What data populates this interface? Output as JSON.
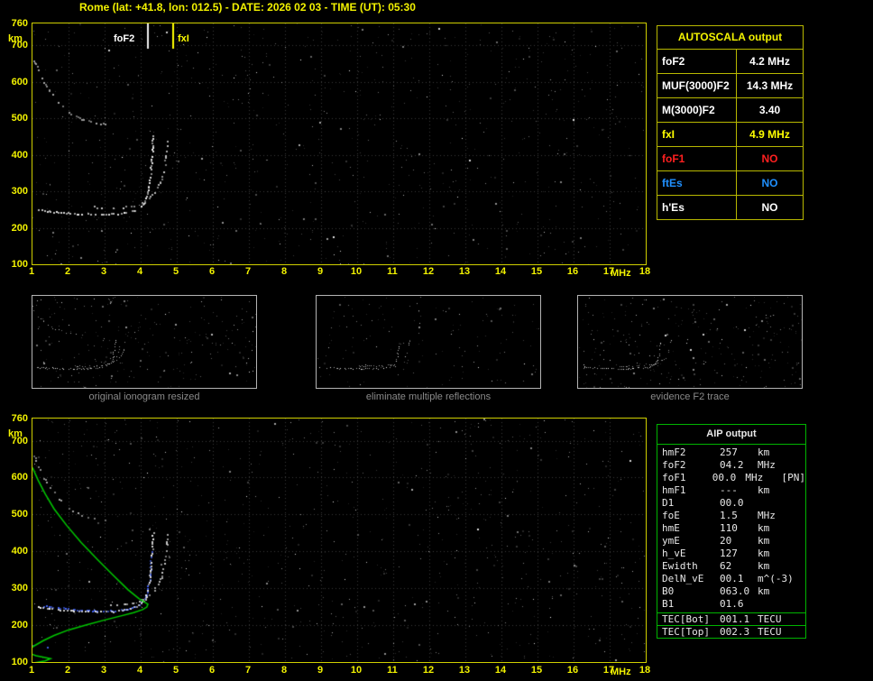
{
  "header": {
    "title": "Rome (lat: +41.8, lon: 012.5) - DATE: 2026 02 03 - TIME (UT): 05:30"
  },
  "colors": {
    "background": "#000000",
    "axis_yellow": "#f2f200",
    "plot_border": "#cfcf00",
    "caption_gray": "#8a8a8a",
    "autoscala_border": "#b8b800",
    "aip_border": "#00b400",
    "profile_green": "#00c800",
    "restored_blue": "#4868ff"
  },
  "autoscala_table": {
    "title": "AUTOSCALA output",
    "rows": [
      {
        "label": "foF2",
        "value": "4.2 MHz",
        "color": "#ffffff"
      },
      {
        "label": "MUF(3000)F2",
        "value": "14.3 MHz",
        "color": "#ffffff"
      },
      {
        "label": "M(3000)F2",
        "value": "3.40",
        "color": "#ffffff"
      },
      {
        "label": "fxI",
        "value": "4.9 MHz",
        "color": "#ffff00"
      },
      {
        "label": "foF1",
        "value": "NO",
        "color": "#ff2020"
      },
      {
        "label": "ftEs",
        "value": "NO",
        "color": "#2090ff"
      },
      {
        "label": "h'Es",
        "value": "NO",
        "color": "#ffffff"
      }
    ]
  },
  "thumbnails": [
    {
      "caption": "original ionogram resized",
      "trace_indices": [
        0,
        1,
        2
      ],
      "noise": 260,
      "seed": 31,
      "xlim": [
        1,
        10
      ],
      "ylim": [
        100,
        760
      ]
    },
    {
      "caption": "eliminate multiple reflections",
      "trace_indices": [
        1,
        2
      ],
      "noise": 150,
      "seed": 32,
      "xlim": [
        1,
        10
      ],
      "ylim": [
        100,
        760
      ]
    },
    {
      "caption": "evidence F2 trace",
      "trace_indices": [
        1,
        2
      ],
      "noise": 300,
      "seed": 33,
      "xlim": [
        1,
        10
      ],
      "ylim": [
        100,
        760
      ]
    }
  ],
  "aip_table": {
    "title": "AIP output",
    "rows": [
      {
        "label": "hmF2",
        "value": "257",
        "unit": "km",
        "note": ""
      },
      {
        "label": "foF2",
        "value": "04.2",
        "unit": "MHz",
        "note": ""
      },
      {
        "label": "foF1",
        "value": "00.0",
        "unit": "MHz",
        "note": "[PN]"
      },
      {
        "label": "hmF1",
        "value": "---",
        "unit": "km",
        "note": ""
      },
      {
        "label": "D1",
        "value": "00.0",
        "unit": "",
        "note": ""
      },
      {
        "label": "foE",
        "value": "1.5",
        "unit": "MHz",
        "note": ""
      },
      {
        "label": "hmE",
        "value": "110",
        "unit": "km",
        "note": ""
      },
      {
        "label": "ymE",
        "value": "20",
        "unit": "km",
        "note": ""
      },
      {
        "label": "h_vE",
        "value": "127",
        "unit": "km",
        "note": ""
      },
      {
        "label": "Ewidth",
        "value": "62",
        "unit": "km",
        "note": ""
      },
      {
        "label": "DelN_vE",
        "value": "00.1",
        "unit": "m^(-3)",
        "note": ""
      },
      {
        "label": "B0",
        "value": "063.0",
        "unit": "km",
        "note": ""
      },
      {
        "label": "B1",
        "value": "01.6",
        "unit": "",
        "note": ""
      }
    ],
    "tec_rows": [
      {
        "label": "TEC[Bot]",
        "value": "001.1",
        "unit": "TECU",
        "note": ""
      },
      {
        "label": "TEC[Top]",
        "value": "002.3",
        "unit": "TECU",
        "note": ""
      }
    ]
  },
  "chart_data": [
    {
      "type": "scatter",
      "name": "scaled ionogram",
      "xlabel": "MHz",
      "ylabel": "km",
      "xlim": [
        1,
        18
      ],
      "ylim": [
        100,
        760
      ],
      "x_ticks": [
        1,
        2,
        3,
        4,
        5,
        6,
        7,
        8,
        9,
        10,
        11,
        12,
        13,
        14,
        15,
        16,
        17,
        18
      ],
      "y_ticks": [
        760,
        700,
        600,
        500,
        400,
        300,
        200,
        100
      ],
      "grid": true,
      "noise": {
        "count": 750,
        "seed": 123
      },
      "annotations": [
        {
          "label": "foF2",
          "freq": 4.2,
          "label_color": "#ffffff",
          "line_color": "#f0f0f0",
          "side": "left"
        },
        {
          "label": "fxI",
          "freq": 4.9,
          "label_color": "#ffff00",
          "line_color": "#ffff00",
          "side": "right"
        }
      ],
      "traces": [
        {
          "name": "multiple-reflection-trace",
          "color": "#b0b0b0",
          "size": 2,
          "drop": 0.5,
          "points": [
            [
              1.05,
              660
            ],
            [
              1.2,
              622
            ],
            [
              1.4,
              585
            ],
            [
              1.65,
              550
            ],
            [
              1.95,
              522
            ],
            [
              2.3,
              502
            ],
            [
              2.7,
              490
            ],
            [
              3.05,
              484
            ]
          ]
        },
        {
          "name": "F2-extraordinary",
          "color": "#c8c8c8",
          "size": 2,
          "drop": 0.45,
          "points": [
            [
              2.7,
              258
            ],
            [
              3.1,
              255
            ],
            [
              3.5,
              257
            ],
            [
              3.8,
              262
            ],
            [
              4.0,
              270
            ],
            [
              4.2,
              283
            ],
            [
              4.4,
              302
            ],
            [
              4.55,
              330
            ],
            [
              4.65,
              368
            ],
            [
              4.7,
              412
            ],
            [
              4.73,
              452
            ]
          ]
        },
        {
          "name": "F2-ordinary",
          "color": "#f0f0f0",
          "size": 2,
          "drop": 0.2,
          "points": [
            [
              1.15,
              252
            ],
            [
              1.5,
              246
            ],
            [
              1.9,
              242
            ],
            [
              2.4,
              239
            ],
            [
              2.9,
              238
            ],
            [
              3.3,
              240
            ],
            [
              3.6,
              244
            ],
            [
              3.85,
              250
            ],
            [
              4.0,
              259
            ],
            [
              4.1,
              272
            ],
            [
              4.18,
              294
            ],
            [
              4.24,
              330
            ],
            [
              4.28,
              372
            ],
            [
              4.31,
              416
            ],
            [
              4.33,
              458
            ]
          ]
        }
      ]
    },
    {
      "type": "scatter",
      "name": "restored ionogram with electron density profile",
      "xlabel": "MHz",
      "ylabel": "km",
      "xlim": [
        1,
        18
      ],
      "ylim": [
        100,
        760
      ],
      "x_ticks": [
        1,
        2,
        3,
        4,
        5,
        6,
        7,
        8,
        9,
        10,
        11,
        12,
        13,
        14,
        15,
        16,
        17,
        18
      ],
      "y_ticks": [
        760,
        700,
        600,
        500,
        400,
        300,
        200,
        100
      ],
      "grid": true,
      "noise": {
        "count": 800,
        "seed": 456
      },
      "annotations": [],
      "traces": [
        {
          "name": "multiple-reflection-trace",
          "color": "#b0b0b0",
          "size": 2,
          "drop": 0.55,
          "points": [
            [
              1.05,
              660
            ],
            [
              1.2,
              622
            ],
            [
              1.4,
              585
            ],
            [
              1.65,
              550
            ],
            [
              1.95,
              522
            ],
            [
              2.3,
              502
            ],
            [
              2.7,
              490
            ],
            [
              3.05,
              484
            ]
          ]
        },
        {
          "name": "F2-extraordinary",
          "color": "#c8c8c8",
          "size": 2,
          "drop": 0.45,
          "points": [
            [
              2.7,
              258
            ],
            [
              3.1,
              255
            ],
            [
              3.5,
              257
            ],
            [
              3.8,
              262
            ],
            [
              4.0,
              270
            ],
            [
              4.2,
              283
            ],
            [
              4.4,
              302
            ],
            [
              4.55,
              330
            ],
            [
              4.65,
              368
            ],
            [
              4.7,
              412
            ],
            [
              4.73,
              452
            ]
          ]
        },
        {
          "name": "restored-trace-blue",
          "color": "#4868ff",
          "size": 2,
          "drop": 0.25,
          "points": [
            [
              1.3,
              254
            ],
            [
              1.7,
              248
            ],
            [
              2.1,
              244
            ],
            [
              2.5,
              241
            ],
            [
              2.9,
              240
            ],
            [
              3.2,
              241
            ],
            [
              3.5,
              244
            ],
            [
              3.75,
              250
            ],
            [
              3.95,
              258
            ],
            [
              4.08,
              270
            ],
            [
              4.17,
              290
            ],
            [
              4.23,
              324
            ],
            [
              4.27,
              364
            ],
            [
              4.3,
              407
            ]
          ]
        },
        {
          "name": "restored-E-blue",
          "color": "#4868ff",
          "size": 2,
          "drop": 0.2,
          "points": [
            [
              1.0,
              146
            ],
            [
              1.15,
              143
            ],
            [
              1.3,
              141
            ],
            [
              1.45,
              140
            ]
          ]
        },
        {
          "name": "F2-ordinary",
          "color": "#f0f0f0",
          "size": 2,
          "drop": 0.2,
          "points": [
            [
              1.15,
              252
            ],
            [
              1.5,
              246
            ],
            [
              1.9,
              242
            ],
            [
              2.4,
              239
            ],
            [
              2.9,
              238
            ],
            [
              3.3,
              240
            ],
            [
              3.6,
              244
            ],
            [
              3.85,
              250
            ],
            [
              4.0,
              259
            ],
            [
              4.1,
              272
            ],
            [
              4.18,
              294
            ],
            [
              4.24,
              330
            ],
            [
              4.28,
              372
            ],
            [
              4.31,
              416
            ],
            [
              4.33,
              458
            ]
          ]
        }
      ],
      "profile": {
        "name": "electron-density-profile",
        "color": "#00c800",
        "points": [
          [
            1.0,
            627
          ],
          [
            1.15,
            594
          ],
          [
            1.35,
            556
          ],
          [
            1.6,
            515
          ],
          [
            1.95,
            470
          ],
          [
            2.35,
            424
          ],
          [
            2.8,
            378
          ],
          [
            3.25,
            334
          ],
          [
            3.65,
            296
          ],
          [
            3.95,
            272
          ],
          [
            4.15,
            260
          ],
          [
            4.2,
            257
          ],
          [
            4.17,
            249
          ],
          [
            4.05,
            242
          ],
          [
            3.8,
            234
          ],
          [
            3.45,
            225
          ],
          [
            3.0,
            214
          ],
          [
            2.5,
            201
          ],
          [
            2.0,
            187
          ],
          [
            1.6,
            172
          ],
          [
            1.3,
            158
          ],
          [
            1.05,
            144
          ],
          [
            0.9,
            133
          ],
          [
            0.92,
            124
          ],
          [
            1.1,
            117
          ],
          [
            1.35,
            112
          ],
          [
            1.5,
            109
          ],
          [
            1.35,
            103
          ],
          [
            1.05,
            98
          ],
          [
            0.7,
            94
          ],
          [
            0.4,
            91
          ]
        ]
      }
    }
  ]
}
